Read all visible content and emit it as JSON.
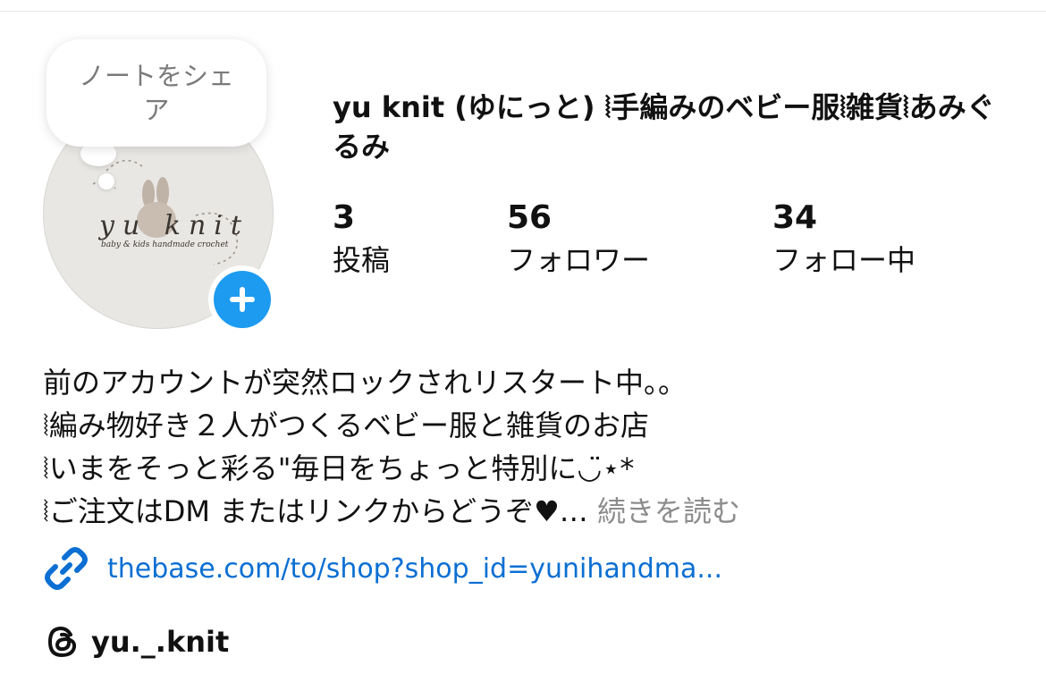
{
  "note": {
    "text": "ノートをシェア"
  },
  "avatar": {
    "logo_title": "yu knit",
    "logo_subtitle": "baby & kids handmade crochet",
    "add_icon": "plus-icon"
  },
  "profile": {
    "name": "yu knit (ゆにっと) ⦚手編みのベビー服⦚雑貨⦚あみぐるみ"
  },
  "stats": [
    {
      "value": "3",
      "label": "投稿"
    },
    {
      "value": "56",
      "label": "フォロワー"
    },
    {
      "value": "34",
      "label": "フォロー中"
    }
  ],
  "bio": {
    "lines": [
      "前のアカウントが突然ロックされリスタート中。。",
      "⦚編み物好き２人がつくるベビー服と雑貨のお店",
      "⦚いまをそっと彩る\"毎日をちょっと特別に◡̈⋆*",
      "⦚ご注文はDM またはリンクからどうぞ♥︎…"
    ],
    "more_label": "続きを読む"
  },
  "link": {
    "icon": "link-icon",
    "text": "thebase.com/to/shop?shop_id=yunihandma..."
  },
  "threads": {
    "icon": "threads-icon",
    "handle": "yu._.knit"
  },
  "colors": {
    "accent": "#1d9bf0",
    "link": "#0b6fd3",
    "muted": "#8c8c8c"
  }
}
